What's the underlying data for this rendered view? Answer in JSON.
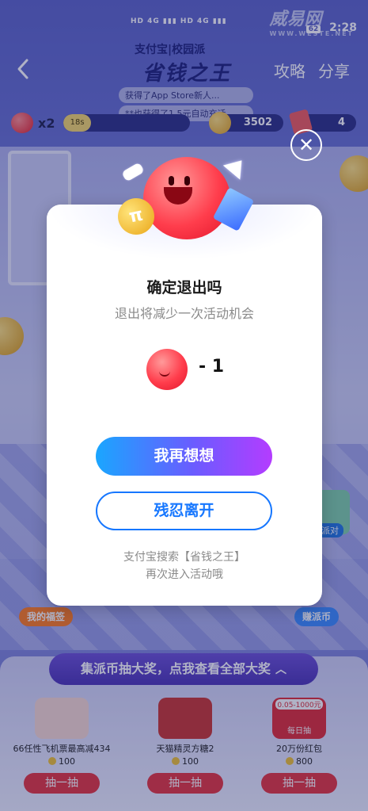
{
  "status_bar": {
    "time": "2:28",
    "battery": "62",
    "watermark_text": "威易网",
    "watermark_url": "WWW.WESTE.NET"
  },
  "nav": {
    "app_logo": "支付宝|校园派",
    "title": "省钱之王",
    "strategy_label": "攻略",
    "share_label": "分享"
  },
  "ticker": [
    "获得了App Store新人...",
    "**也获得了1.5元自动充话..."
  ],
  "topbar": {
    "lives": "x2",
    "progress_text": "18s",
    "progress_fraction": 0.22,
    "coins": "3502",
    "cards": "4"
  },
  "side_buttons": {
    "blessing": "我的福签",
    "earn": "赚派币",
    "pie": "派对"
  },
  "modal": {
    "title": "确定退出吗",
    "subtitle": "退出将减少一次活动机会",
    "cost": "- 1",
    "confirm_stay": "我再想想",
    "confirm_leave": "残忍离开",
    "hint_line1": "支付宝搜索【省钱之王】",
    "hint_line2": "再次进入活动哦"
  },
  "bottom": {
    "banner": "集派币抽大奖，点我查看全部大奖",
    "prizes": [
      {
        "name": "66任性飞机票最高减434",
        "price": "100",
        "draw": "抽一抽",
        "color": "#f7d9d2"
      },
      {
        "name": "天猫精灵方糖2",
        "price": "100",
        "draw": "抽一抽",
        "color": "#c9342f"
      },
      {
        "name": "20万份红包",
        "price": "800",
        "draw": "抽一抽",
        "color": "#e02a34",
        "badge": "0.05-1000元",
        "tag": "每日抽"
      }
    ]
  },
  "colors": {
    "accent_blue": "#1677ff",
    "gradient_start": "#1aa6ff",
    "gradient_end": "#b43cff",
    "draw_red": "#e5333d"
  }
}
